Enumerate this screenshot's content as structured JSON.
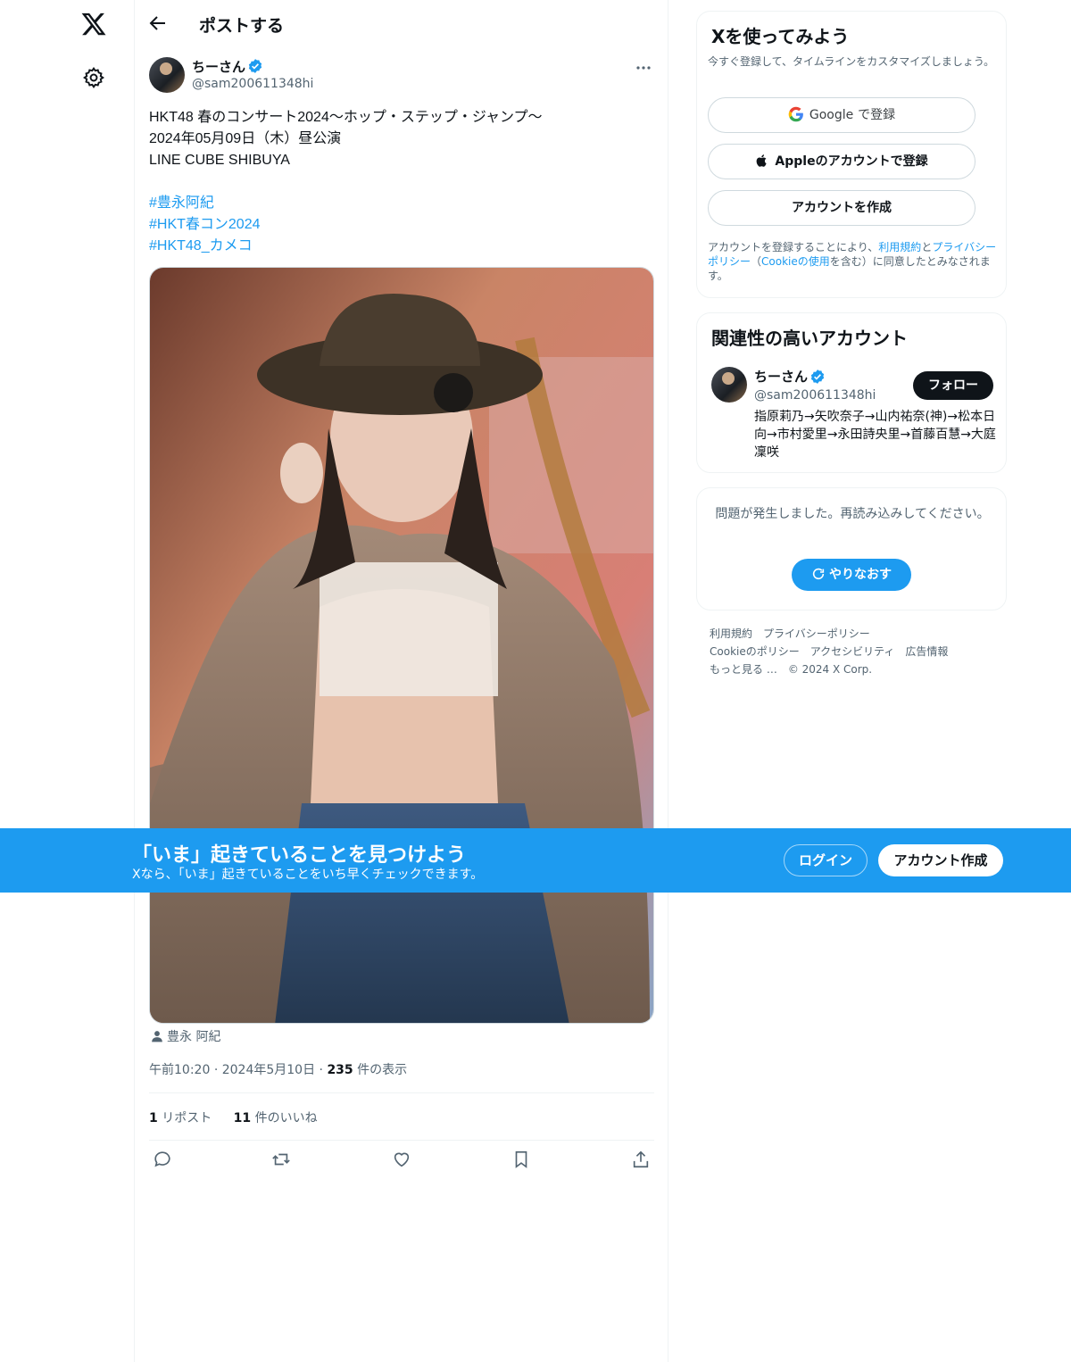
{
  "nav": {
    "logo": "x-logo-icon",
    "settings": "gear-icon"
  },
  "header": {
    "title": "ポストする"
  },
  "post": {
    "author_name": "ちーさん",
    "author_handle": "@sam200611348hi",
    "text_lines": [
      "HKT48 春のコンサート2024〜ホップ・ステップ・ジャンプ〜",
      "2024年05月09日（木）昼公演",
      "LINE CUBE SHIBUYA"
    ],
    "hashtags": [
      "#豊永阿紀",
      "#HKT春コン2024",
      "#HKT48_カメコ"
    ],
    "tagged_user": "豊永 阿紀",
    "time": "午前10:20",
    "date": "2024年5月10日",
    "views_count": "235",
    "views_label": "件の表示",
    "reposts_count": "1",
    "reposts_label": "リポスト",
    "likes_count": "11",
    "likes_label": "件のいいね"
  },
  "signup": {
    "title": "Xを使ってみよう",
    "desc": "今すぐ登録して、タイムラインをカスタマイズしましょう。",
    "google_brand": "Google",
    "google_label": "で登録",
    "apple_label": "Appleのアカウントで登録",
    "create_label": "アカウントを作成",
    "terms_prefix": "アカウントを登録することにより、",
    "terms_link1": "利用規約",
    "terms_and": "と",
    "terms_link2": "プライバシーポリシー",
    "terms_paren_open": "（",
    "terms_link3": "Cookieの使用",
    "terms_suffix": "を含む）に同意したとみなされます。"
  },
  "related": {
    "title": "関連性の高いアカウント",
    "name": "ちーさん",
    "handle": "@sam200611348hi",
    "bio": "指原莉乃→矢吹奈子→山内祐奈(神)→松本日向→市村愛里→永田詩央里→首藤百慧→大庭凜咲",
    "follow_label": "フォロー"
  },
  "error": {
    "text": "問題が発生しました。再読み込みしてください。",
    "retry_label": "やりなおす"
  },
  "footer": {
    "links": [
      "利用規約",
      "プライバシーポリシー",
      "Cookieのポリシー",
      "アクセシビリティ",
      "広告情報",
      "もっと見る …",
      "© 2024 X Corp."
    ]
  },
  "banner": {
    "title": "「いま」起きていることを見つけよう",
    "subtitle": "Xなら、「いま」起きていることをいち早くチェックできます。",
    "login_label": "ログイン",
    "create_label": "アカウント作成"
  },
  "colors": {
    "accent": "#1d9bf0",
    "text": "#0f1419",
    "muted": "#536471",
    "border": "#eff3f4"
  }
}
